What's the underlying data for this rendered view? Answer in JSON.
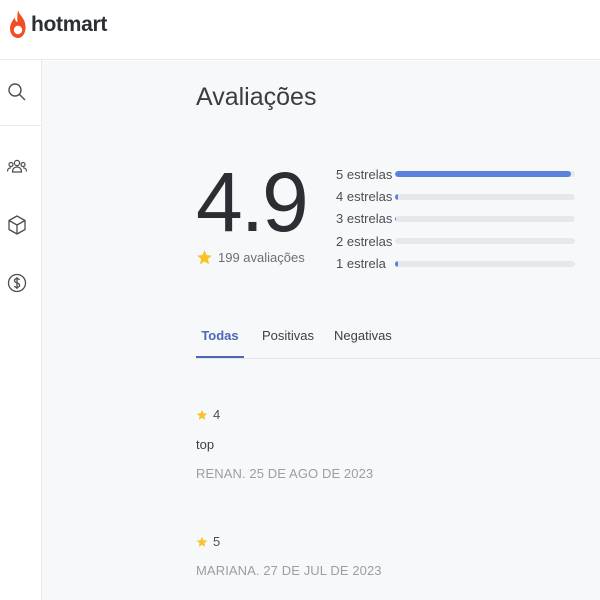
{
  "brand": {
    "name": "hotmart",
    "color": "#f04e23"
  },
  "sidebar": {
    "items": [
      {
        "icon": "search-icon"
      },
      {
        "icon": "users-icon"
      },
      {
        "icon": "box-icon"
      },
      {
        "icon": "dollar-icon"
      }
    ]
  },
  "page": {
    "title": "Avaliações"
  },
  "summary": {
    "rating": "4.9",
    "count_label": "199 avaliações",
    "distribution": [
      {
        "label": "5 estrelas",
        "fraction": 0.98
      },
      {
        "label": "4 estrelas",
        "fraction": 0.015
      },
      {
        "label": "3 estrelas",
        "fraction": 0.005
      },
      {
        "label": "2 estrelas",
        "fraction": 0.0
      },
      {
        "label": "1 estrela",
        "fraction": 0.015
      }
    ]
  },
  "tabs": [
    {
      "label": "Todas",
      "active": true
    },
    {
      "label": "Positivas",
      "active": false
    },
    {
      "label": "Negativas",
      "active": false
    }
  ],
  "reviews": [
    {
      "rating": "4",
      "text": "top",
      "meta": "RENAN. 25 DE AGO DE 2023"
    },
    {
      "rating": "5",
      "text": "",
      "meta": "MARIANA. 27 DE JUL DE 2023"
    }
  ],
  "colors": {
    "accent": "#4a67b8",
    "bar": "#5a82dc",
    "star": "#f7c325"
  }
}
